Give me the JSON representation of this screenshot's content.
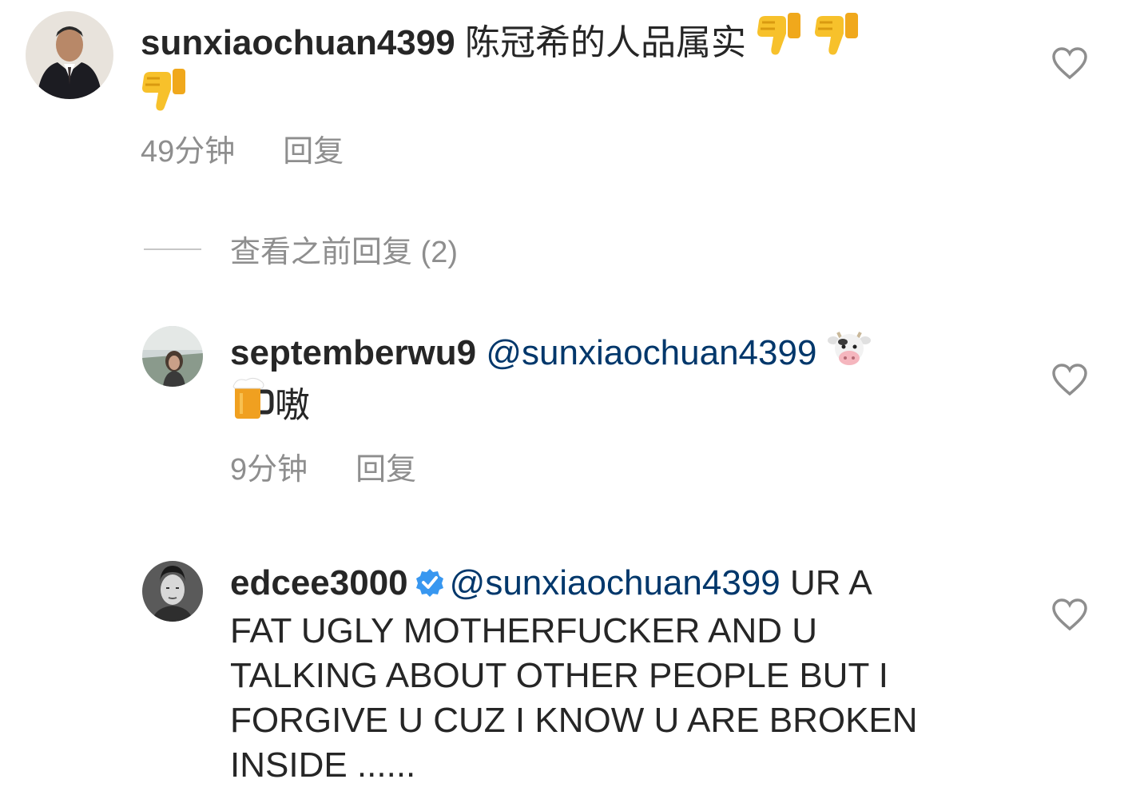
{
  "comments": [
    {
      "username": "sunxiaochuan4399",
      "text": "陈冠希的人品属实",
      "emojis": [
        "thumbs-down",
        "thumbs-down",
        "thumbs-down"
      ],
      "time": "49分钟",
      "reply_label": "回复"
    },
    {
      "username": "septemberwu9",
      "mention": "@sunxiaochuan4399",
      "emojis": [
        "cow-face",
        "beer-mug"
      ],
      "text": "嗷",
      "time": "9分钟",
      "reply_label": "回复"
    },
    {
      "username": "edcee3000",
      "verified": true,
      "mention": "@sunxiaochuan4399",
      "text_line1": "UR A",
      "text_line2": "FAT UGLY MOTHERFUCKER AND U",
      "text_line3": "TALKING ABOUT OTHER PEOPLE BUT I",
      "text_line4": "FORGIVE U CUZ I KNOW U ARE BROKEN",
      "text_line5": "INSIDE ......"
    }
  ],
  "view_previous_replies": "查看之前回复 (2)",
  "colors": {
    "text": "#262626",
    "meta": "#8e8e8e",
    "mention": "#00376b",
    "verified": "#3897f0",
    "emoji_yellow": "#f7c12b"
  }
}
